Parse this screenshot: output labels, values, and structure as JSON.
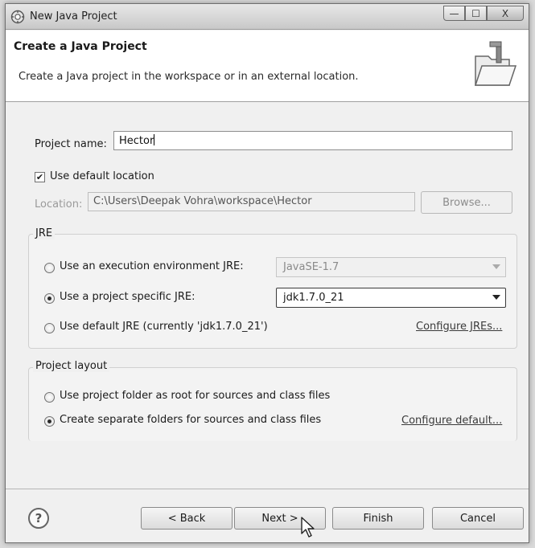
{
  "window": {
    "title": "New Java Project",
    "controls": {
      "minimize": "—",
      "maximize": "☐",
      "close": "X"
    }
  },
  "header": {
    "title": "Create a Java Project",
    "description": "Create a Java project in the workspace or in an external location."
  },
  "project": {
    "name_label": "Project name:",
    "name_value": "Hector",
    "use_default_location_label": "Use default location",
    "use_default_location_checked": true,
    "location_label": "Location:",
    "location_value": "C:\\Users\\Deepak Vohra\\workspace\\Hector",
    "browse_label": "Browse..."
  },
  "jre": {
    "group_title": "JRE",
    "options": [
      {
        "label": "Use an execution environment JRE:",
        "selected": false
      },
      {
        "label": "Use a project specific JRE:",
        "selected": true
      },
      {
        "label": "Use default JRE (currently 'jdk1.7.0_21')",
        "selected": false
      }
    ],
    "env_combo_value": "JavaSE-1.7",
    "specific_combo_value": "jdk1.7.0_21",
    "configure_link": "Configure JREs..."
  },
  "layout": {
    "group_title": "Project layout",
    "options": [
      {
        "label": "Use project folder as root for sources and class files",
        "selected": false
      },
      {
        "label": "Create separate folders for sources and class files",
        "selected": true
      }
    ],
    "configure_link": "Configure default..."
  },
  "footer": {
    "help_symbol": "?",
    "back_label": "< Back",
    "next_label": "Next >",
    "finish_label": "Finish",
    "cancel_label": "Cancel"
  }
}
